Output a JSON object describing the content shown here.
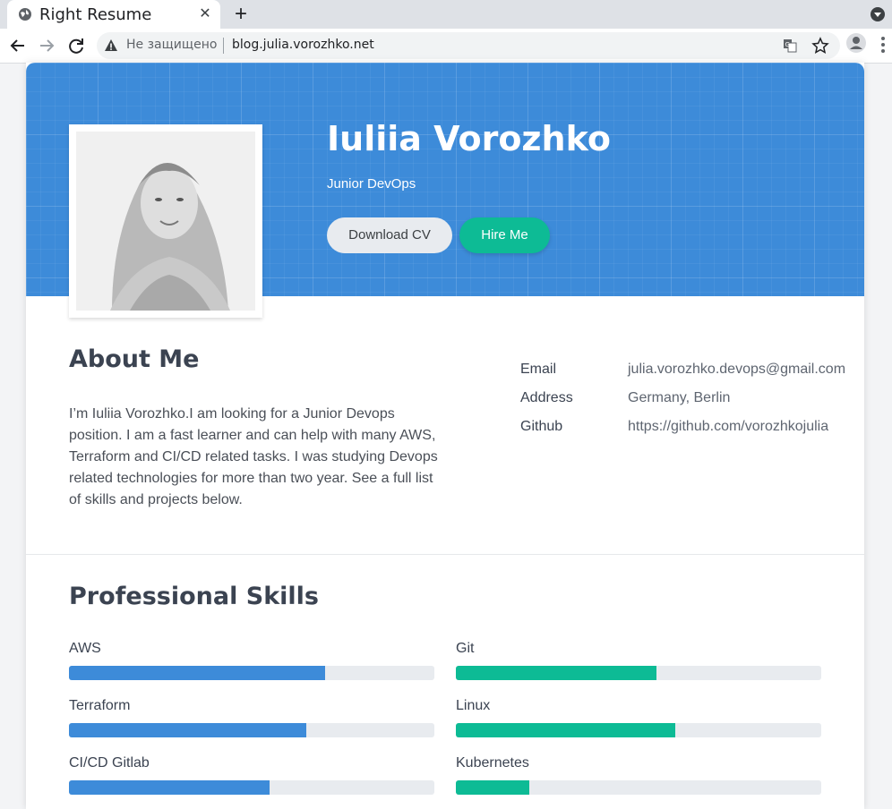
{
  "browser": {
    "tab_title": "Right Resume",
    "insecure_label": "Не защищено",
    "url": "blog.julia.vorozhko.net",
    "icons": [
      "globe-icon",
      "close-icon",
      "plus-icon",
      "back-icon",
      "forward-icon",
      "reload-icon",
      "warning-icon",
      "translate-icon",
      "star-icon",
      "profile-icon",
      "menu-icon"
    ]
  },
  "profile": {
    "name": "Iuliia Vorozhko",
    "role": "Junior DevOps",
    "download_label": "Download CV",
    "hire_label": "Hire Me"
  },
  "about": {
    "title": "About Me",
    "text": "I’m Iuliia Vorozhko.I am looking for a Junior Devops position. I am a fast learner and can help with many AWS, Terraform and CI/CD related tasks. I was studying Devops related technologies for more than two year. See a full list of skills and projects below.",
    "details": [
      {
        "label": "Email",
        "value": "julia.vorozhko.devops@gmail.com"
      },
      {
        "label": "Address",
        "value": "Germany, Berlin"
      },
      {
        "label": "Github",
        "value": "https://github.com/vorozhkojulia"
      }
    ]
  },
  "skills": {
    "title": "Professional Skills",
    "left": [
      {
        "name": "AWS",
        "level": 0.7
      },
      {
        "name": "Terraform",
        "level": 0.65
      },
      {
        "name": "CI/CD Gitlab",
        "level": 0.55
      }
    ],
    "right": [
      {
        "name": "Git",
        "level": 0.55
      },
      {
        "name": "Linux",
        "level": 0.6
      },
      {
        "name": "Kubernetes",
        "level": 0.2
      }
    ]
  },
  "colors": {
    "header_blue": "#3d8bd9",
    "skill_blue": "#3d8bd9",
    "skill_green": "#0dbb95",
    "hire_green": "#0dbb95"
  }
}
